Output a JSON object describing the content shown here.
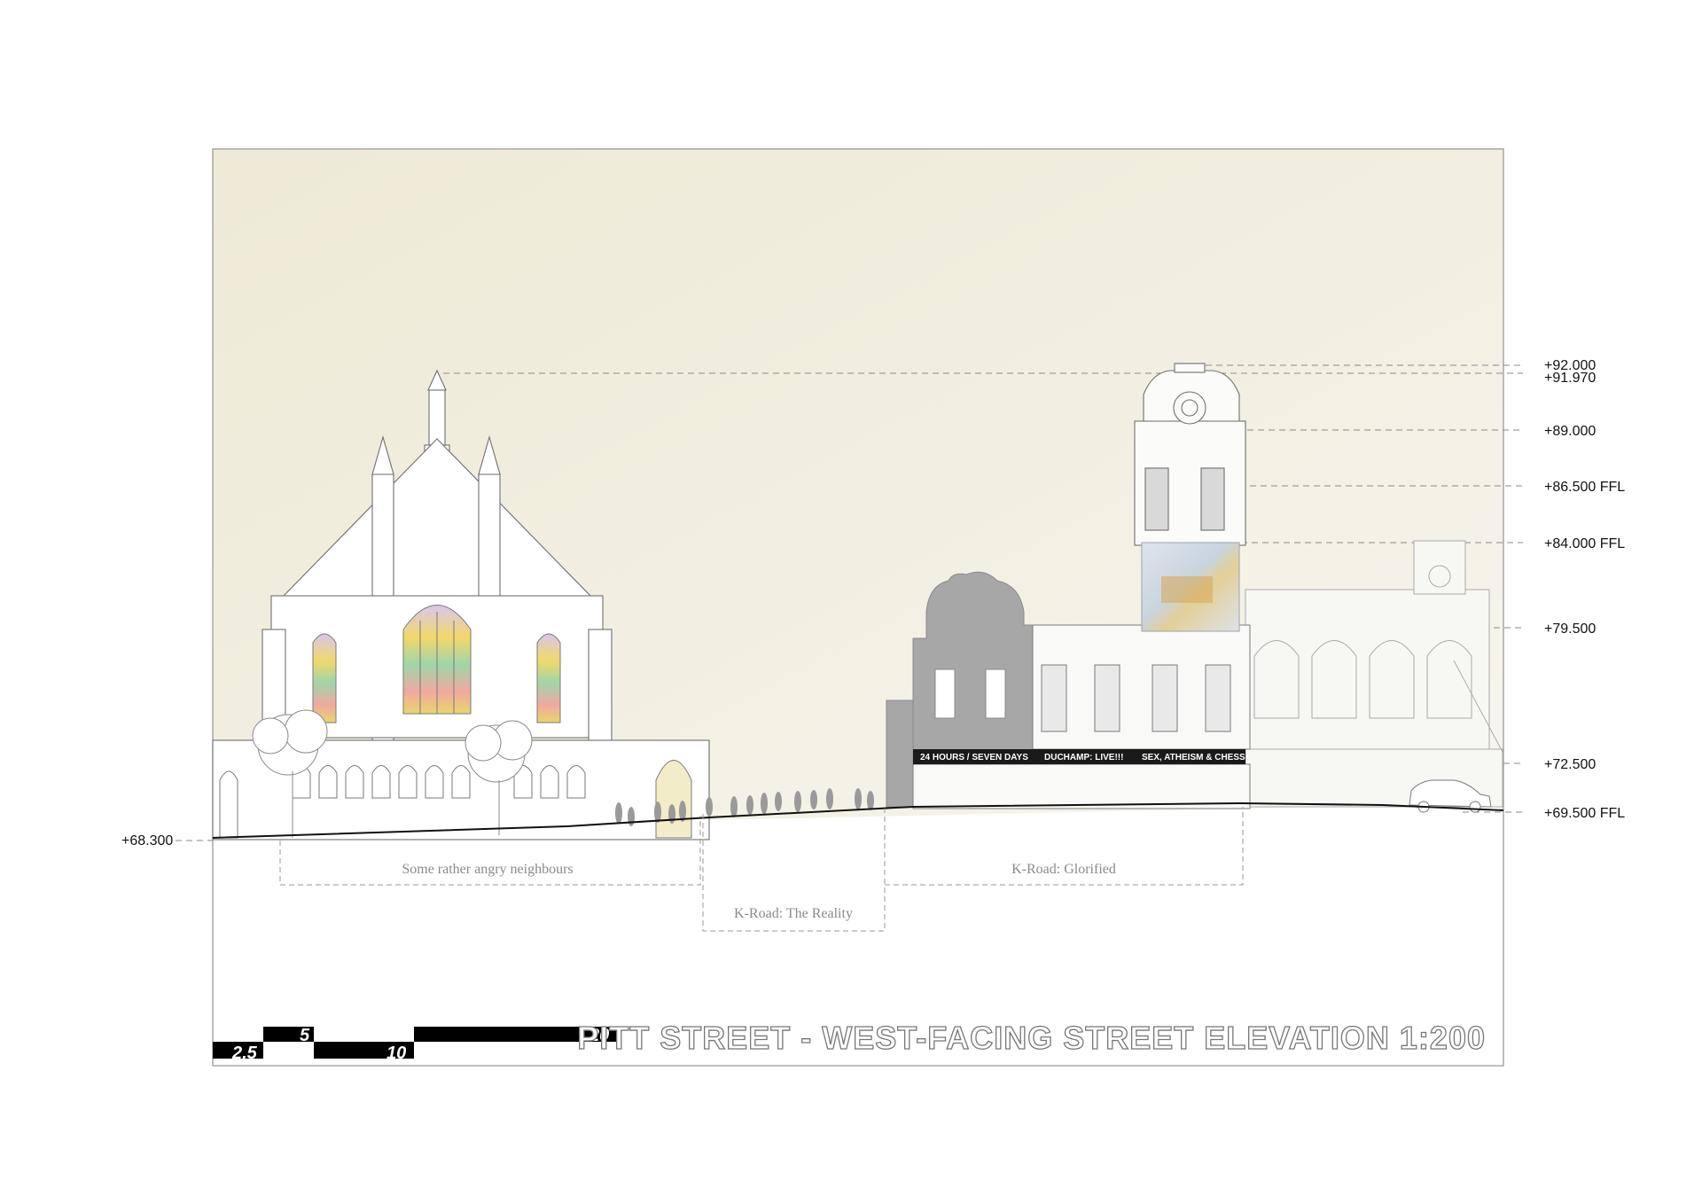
{
  "title": "PITT STREET - WEST-FACING STREET ELEVATION 1:200",
  "levels_right": [
    "+92.000",
    "+91.970",
    "+89.000",
    "+86.500 FFL",
    "+84.000 FFL",
    "+79.500",
    "+72.500",
    "+69.500 FFL"
  ],
  "level_left": "+68.300",
  "zones": {
    "neighbours": "Some rather angry neighbours",
    "reality": "K-Road: The Reality",
    "glorified": "K-Road: Glorified"
  },
  "signs": [
    "24 HOURS / SEVEN DAYS",
    "DUCHAMP: LIVE!!!",
    "SEX, ATHEISM & CHESS!"
  ],
  "scale_bar": {
    "labels": [
      "2.5",
      "5",
      "10",
      "20"
    ]
  },
  "colors": {
    "sky": "#f1eede",
    "frame": "#9a9a9a",
    "line": "#6f6f6f",
    "grey_building": "#a7a7a7",
    "sign_band": "#1a1a1a"
  }
}
